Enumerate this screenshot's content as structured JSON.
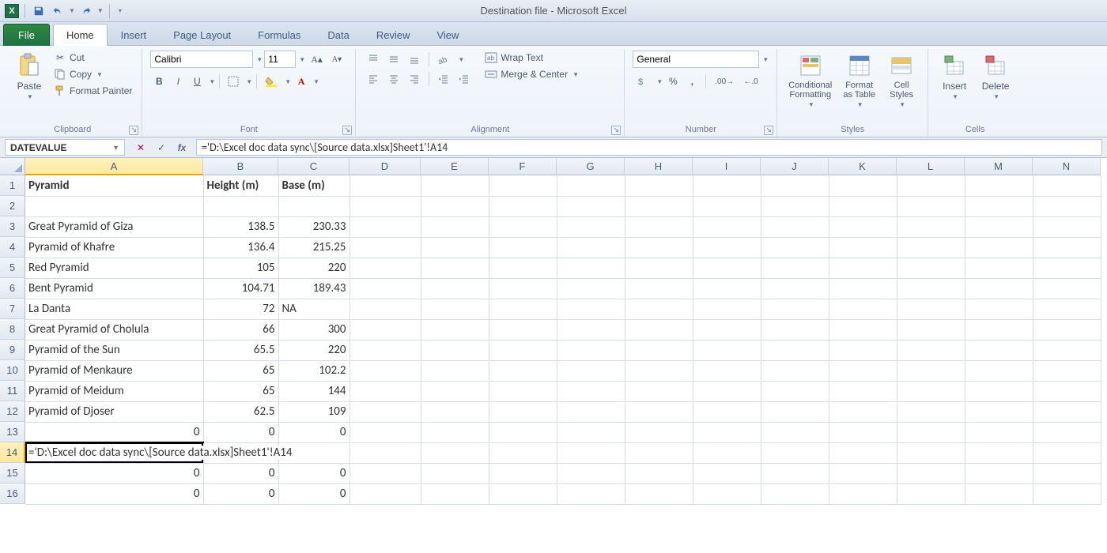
{
  "app": {
    "title": "Destination file  -  Microsoft Excel",
    "excel_icon_letter": "X"
  },
  "qat": {
    "save": "save-icon",
    "undo": "undo-icon",
    "redo": "redo-icon"
  },
  "tabs": {
    "file": "File",
    "items": [
      "Home",
      "Insert",
      "Page Layout",
      "Formulas",
      "Data",
      "Review",
      "View"
    ],
    "active_index": 0
  },
  "ribbon": {
    "clipboard": {
      "label": "Clipboard",
      "paste": "Paste",
      "cut": "Cut",
      "copy": "Copy",
      "format_painter": "Format Painter"
    },
    "font": {
      "label": "Font",
      "name": "Calibri",
      "size": "11",
      "bold": "B",
      "italic": "I",
      "underline": "U"
    },
    "alignment": {
      "label": "Alignment",
      "wrap_text": "Wrap Text",
      "merge_center": "Merge & Center"
    },
    "number": {
      "label": "Number",
      "format": "General",
      "percent": "%",
      "comma": ","
    },
    "styles": {
      "label": "Styles",
      "conditional_formatting": "Conditional\nFormatting",
      "format_as_table": "Format\nas Table",
      "cell_styles": "Cell\nStyles"
    },
    "cells": {
      "label": "Cells",
      "insert": "Insert",
      "delete": "Delete"
    }
  },
  "formula_bar": {
    "name_box": "DATEVALUE",
    "formula": "='D:\\Excel doc data sync\\[Source data.xlsx]Sheet1'!A14",
    "fx": "fx"
  },
  "grid": {
    "columns": [
      "A",
      "B",
      "C",
      "D",
      "E",
      "F",
      "G",
      "H",
      "I",
      "J",
      "K",
      "L",
      "M",
      "N"
    ],
    "active_col": "A",
    "active_row": 14,
    "headers": {
      "A": "Pyramid",
      "B": "Height (m)",
      "C": "Base (m)"
    },
    "rows": [
      {
        "A": "Great Pyramid of Giza",
        "B": "138.5",
        "C": "230.33"
      },
      {
        "A": "Pyramid of Khafre",
        "B": "136.4",
        "C": "215.25"
      },
      {
        "A": "Red Pyramid",
        "B": "105",
        "C": "220"
      },
      {
        "A": "Bent Pyramid",
        "B": "104.71",
        "C": "189.43"
      },
      {
        "A": "La Danta",
        "B": "72",
        "C_text": "NA"
      },
      {
        "A": "Great Pyramid of Cholula",
        "B": "66",
        "C": "300"
      },
      {
        "A": "Pyramid of the Sun",
        "B": "65.5",
        "C": "220"
      },
      {
        "A": "Pyramid of Menkaure",
        "B": "65",
        "C": "102.2"
      },
      {
        "A": "Pyramid of Meidum",
        "B": "65",
        "C": "144"
      },
      {
        "A": "Pyramid of Djoser",
        "B": "62.5",
        "C": "109"
      }
    ],
    "zero_row": {
      "A": "0",
      "B": "0",
      "C": "0"
    },
    "editing_row_display": "='D:\\Excel doc data sync\\[Source data.xlsx]Sheet1'!A14"
  }
}
